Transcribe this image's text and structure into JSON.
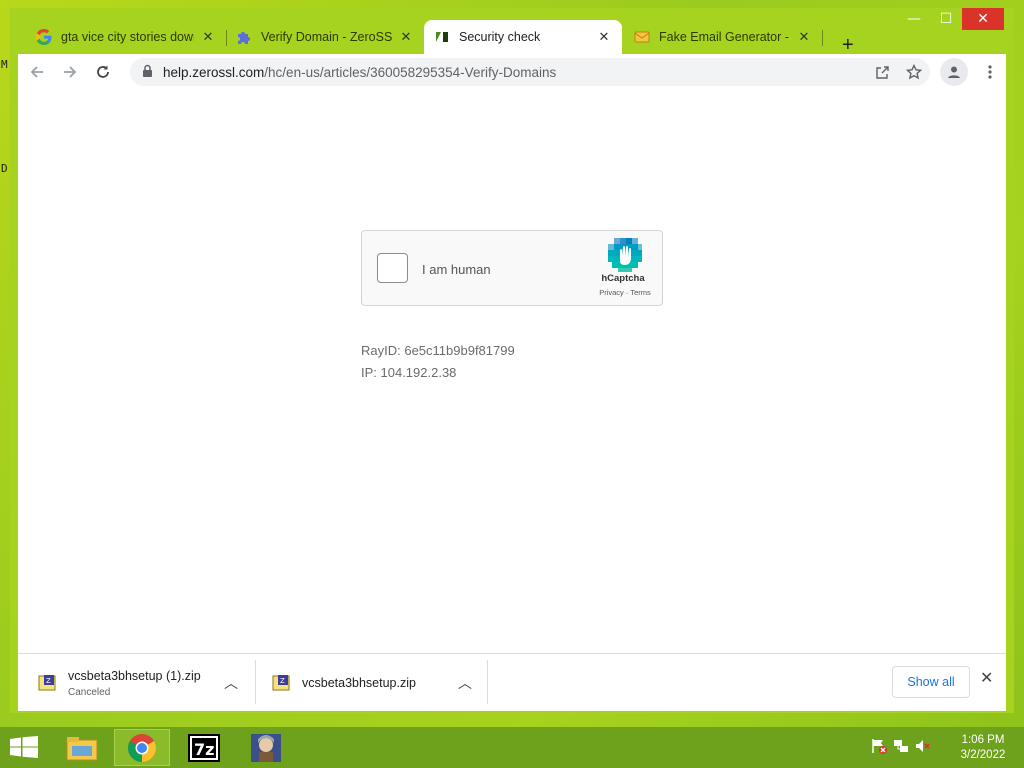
{
  "desktop": {
    "left_glyphs": [
      "M",
      "D"
    ]
  },
  "window": {
    "controls": {
      "minimize": "—",
      "maximize": "☐",
      "close": "✕"
    }
  },
  "tabs": [
    {
      "title": "gta vice city stories down",
      "icon": "google-g-icon"
    },
    {
      "title": "Verify Domain - ZeroSSL",
      "icon": "puzzle-icon"
    },
    {
      "title": "Security check",
      "icon": "zendesk-icon",
      "active": true
    },
    {
      "title": "Fake Email Generator - te",
      "icon": "envelope-icon"
    }
  ],
  "tab_close": "✕",
  "new_tab": "+",
  "address_bar": {
    "host": "help.zerossl.com",
    "path": "/hc/en-us/articles/360058295354-Verify-Domains"
  },
  "captcha": {
    "label": "I am human",
    "brand": "hCaptcha",
    "links": "Privacy · Terms"
  },
  "ray_info": {
    "ray_id": "RayID: 6e5c11b9b9f81799",
    "ip": "IP: 104.192.2.38"
  },
  "downloads": [
    {
      "name": "vcsbeta3bhsetup (1).zip",
      "status": "Canceled"
    },
    {
      "name": "vcsbeta3bhsetup.zip",
      "status": ""
    }
  ],
  "downloads_bar": {
    "show_all": "Show all",
    "close": "✕"
  },
  "taskbar": {
    "clock_time": "1:06 PM",
    "clock_date": "3/2/2022",
    "items": [
      "file-explorer-icon",
      "chrome-icon",
      "7zip-icon",
      "game-icon"
    ]
  },
  "colors": {
    "desktop_bg": "#9bcb1f",
    "taskbar_bg": "#6fa21c",
    "link_blue": "#1a73e8",
    "close_red": "#d9332a"
  }
}
